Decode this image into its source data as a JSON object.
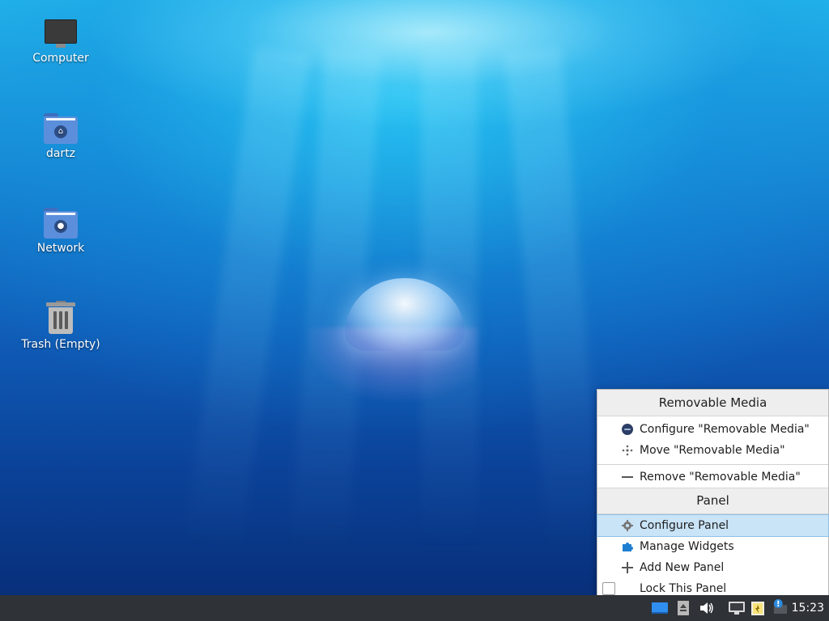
{
  "desktop": {
    "icons": [
      {
        "label": "Computer",
        "icon": "computer-icon"
      },
      {
        "label": "dartz",
        "icon": "home-folder-icon"
      },
      {
        "label": "Network",
        "icon": "network-folder-icon"
      },
      {
        "label": "Trash (Empty)",
        "icon": "trash-icon"
      }
    ]
  },
  "menu": {
    "section1_title": "Removable Media",
    "section1_items": [
      {
        "label": "Configure \"Removable Media\"",
        "icon": "configure-icon"
      },
      {
        "label": "Move \"Removable Media\"",
        "icon": "move-icon"
      },
      {
        "label": "Remove \"Removable Media\"",
        "icon": "remove-icon"
      }
    ],
    "section2_title": "Panel",
    "section2_items": [
      {
        "label": "Configure Panel",
        "icon": "gear-icon",
        "selected": true
      },
      {
        "label": "Manage Widgets",
        "icon": "puzzle-icon"
      },
      {
        "label": "Add New Panel",
        "icon": "plus-icon"
      },
      {
        "label": "Lock This Panel",
        "icon": "checkbox-icon",
        "checked": false
      }
    ]
  },
  "panel": {
    "clock": "15:23",
    "tray": [
      "removable-media-icon",
      "clipboard-icon",
      "volume-icon",
      "network-icon",
      "battery-icon",
      "update-notifier-icon"
    ]
  },
  "colors": {
    "panel_bg": "#2f3237",
    "selection": "#c9e3f7",
    "accent": "#1e7fd1"
  }
}
